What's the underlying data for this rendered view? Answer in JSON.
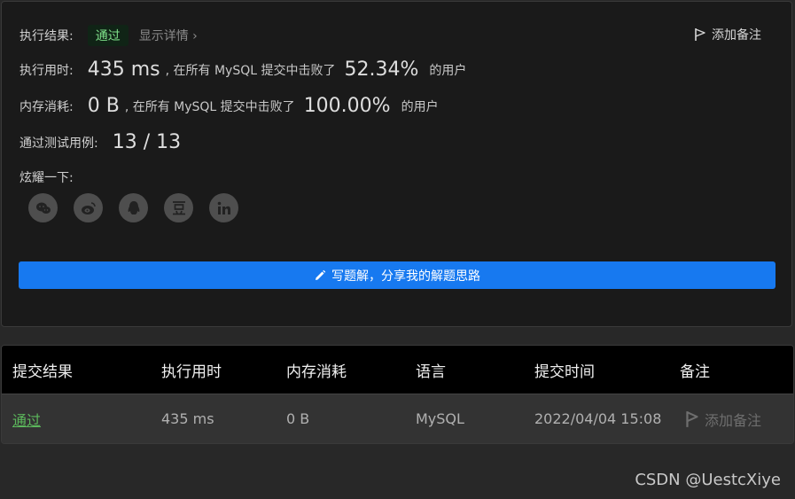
{
  "result": {
    "label": "执行结果:",
    "status": "通过",
    "details_link": "显示详情 ›",
    "add_note": "添加备注"
  },
  "runtime": {
    "label": "执行用时:",
    "value": "435 ms",
    "text_before": ", 在所有 MySQL 提交中击败了",
    "percent": "52.34%",
    "text_after": "的用户"
  },
  "memory": {
    "label": "内存消耗:",
    "value": "0 B",
    "text_before": ", 在所有 MySQL 提交中击败了",
    "percent": "100.00%",
    "text_after": "的用户"
  },
  "tests": {
    "label": "通过测试用例:",
    "value": "13 / 13"
  },
  "share": {
    "label": "炫耀一下:",
    "icons": [
      "wechat-icon",
      "weibo-icon",
      "qq-icon",
      "douban-icon",
      "linkedin-icon"
    ]
  },
  "write_solution_button": "写题解，分享我的解题思路",
  "table": {
    "headers": [
      "提交结果",
      "执行用时",
      "内存消耗",
      "语言",
      "提交时间",
      "备注"
    ],
    "row": {
      "status": "通过",
      "runtime": "435 ms",
      "memory": "0 B",
      "language": "MySQL",
      "time": "2022/04/04 15:08",
      "note": "添加备注"
    }
  },
  "watermark": "CSDN @UestcXiye",
  "colors": {
    "accent": "#1779f0",
    "pass_green": "#5cb85c",
    "badge_green": "#7fe08a"
  }
}
